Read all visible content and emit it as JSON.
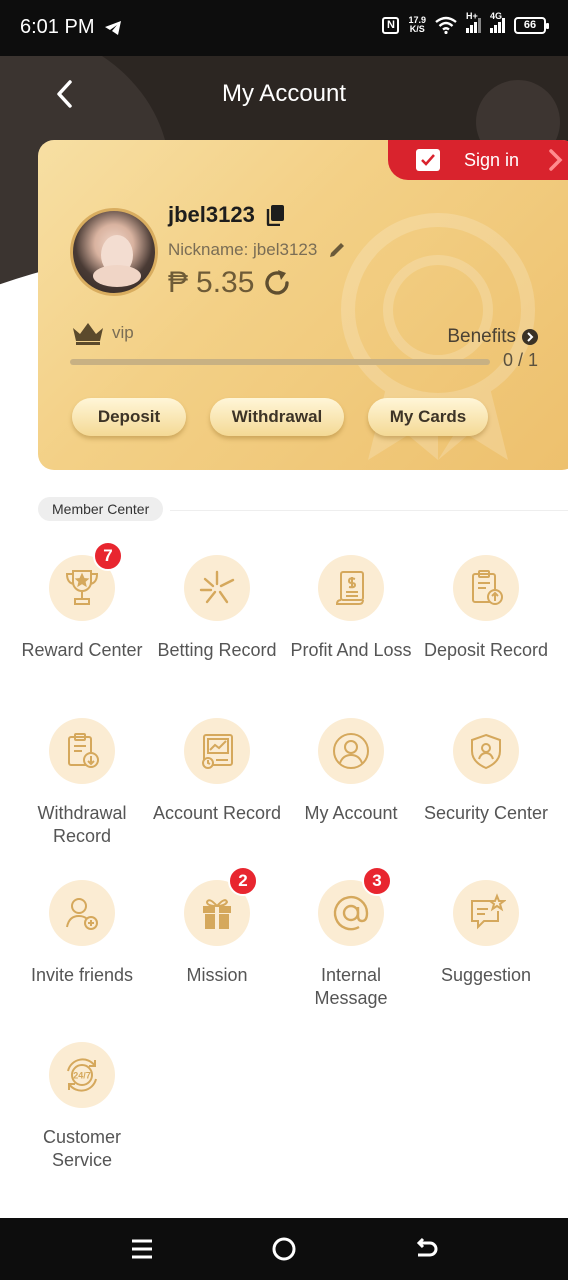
{
  "status_bar": {
    "time": "6:01 PM",
    "nfc": "N",
    "net_speed_value": "17.9",
    "net_speed_unit": "K/S",
    "signal1_label": "H+",
    "signal2_label": "4G",
    "battery": "66"
  },
  "header": {
    "title": "My Account",
    "back_icon": "chevron-left-icon"
  },
  "card": {
    "sign_in_label": "Sign in",
    "username": "jbel3123",
    "nickname": "Nickname: jbel3123",
    "currency_symbol": "₱",
    "balance": "5.35",
    "vip_label": "vip",
    "benefits_label": "Benefits",
    "progress_text": "0 / 1",
    "progress_fraction": 0,
    "buttons": {
      "deposit": "Deposit",
      "withdrawal": "Withdrawal",
      "my_cards": "My Cards"
    }
  },
  "member_center": {
    "title": "Member Center",
    "items": [
      {
        "label": "Reward Center",
        "icon": "trophy-icon",
        "badge": "7"
      },
      {
        "label": "Betting Record",
        "icon": "sparkle-icon",
        "badge": null
      },
      {
        "label": "Profit And Loss",
        "icon": "document-icon",
        "badge": null
      },
      {
        "label": "Deposit Record",
        "icon": "clipboard-upload-icon",
        "badge": null
      },
      {
        "label": "Withdrawal Record",
        "icon": "clipboard-download-icon",
        "badge": null
      },
      {
        "label": "Account Record",
        "icon": "ledger-icon",
        "badge": null
      },
      {
        "label": "My Account",
        "icon": "user-icon",
        "badge": null
      },
      {
        "label": "Security Center",
        "icon": "shield-icon",
        "badge": null
      },
      {
        "label": "Invite friends",
        "icon": "add-user-icon",
        "badge": null
      },
      {
        "label": "Mission",
        "icon": "gift-icon",
        "badge": "2"
      },
      {
        "label": "Internal Message",
        "icon": "at-icon",
        "badge": "3"
      },
      {
        "label": "Suggestion",
        "icon": "message-star-icon",
        "badge": null
      },
      {
        "label": "Customer Service",
        "icon": "24-7-icon",
        "badge": null
      }
    ]
  },
  "nav_bar": {
    "menu_icon": "menu-icon",
    "home_icon": "home-icon",
    "back_icon": "back-icon"
  },
  "colors": {
    "header_bg": "#2c2622",
    "card_gold": "#f3d086",
    "sign_in_red": "#d9232d",
    "badge_red": "#e8262f",
    "icon_bg": "#fbecd3",
    "icon_stroke": "#d5a85c"
  }
}
